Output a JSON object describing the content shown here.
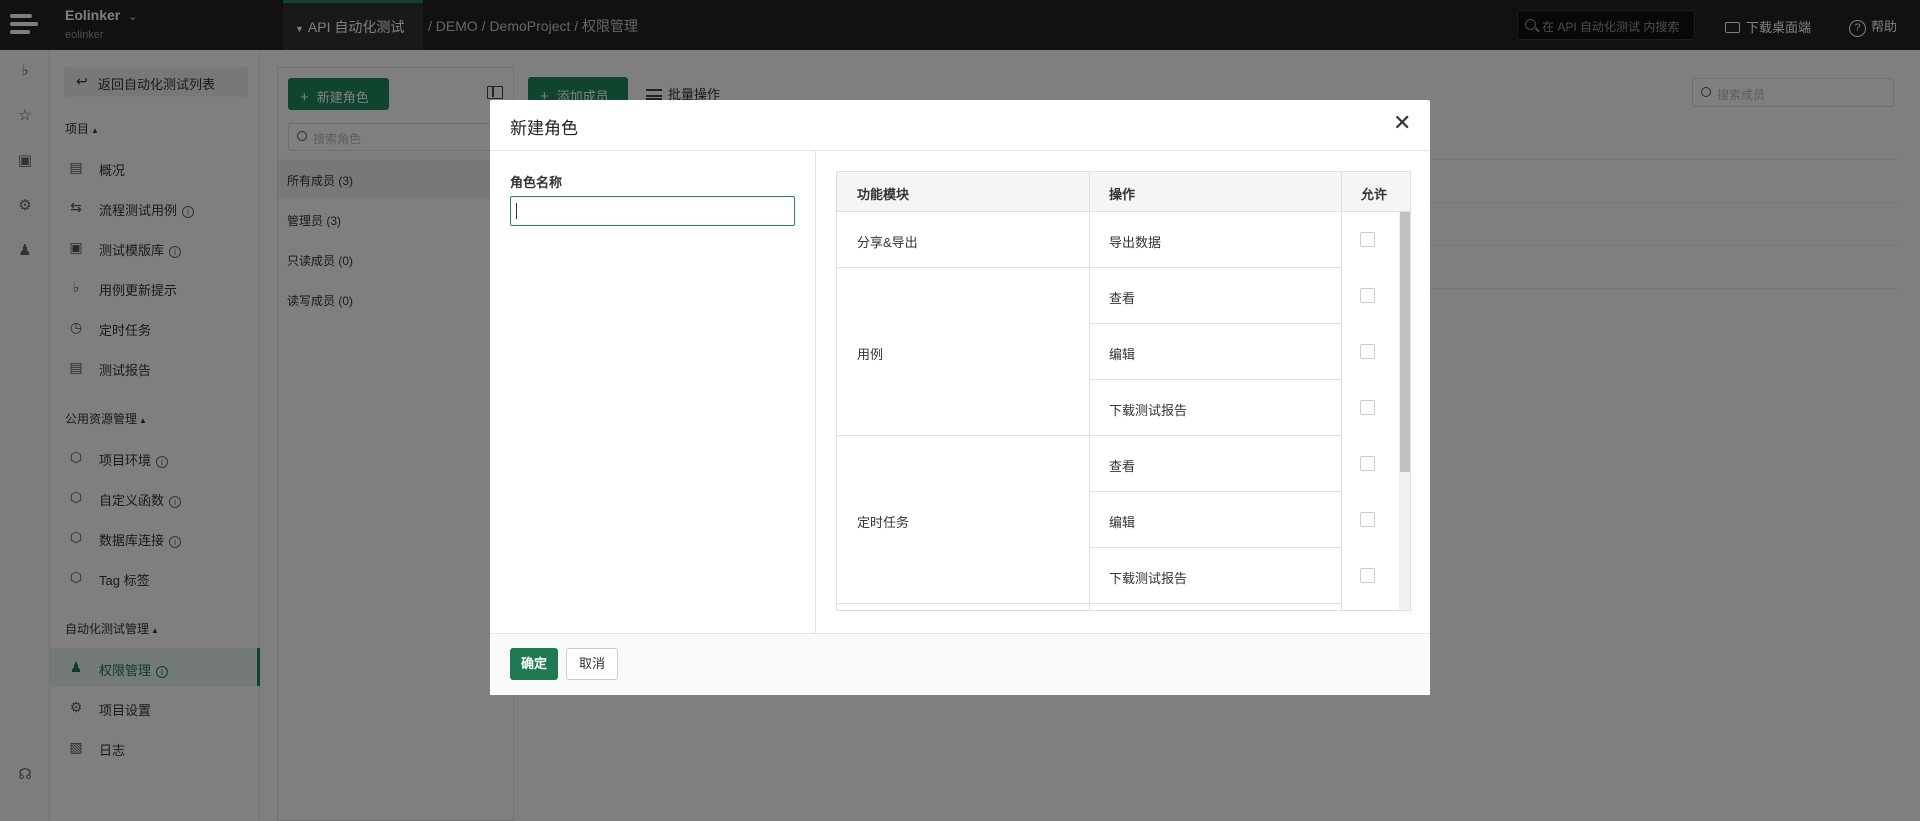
{
  "topbar": {
    "org_name": "Eolinker",
    "org_sub": "eolinker",
    "project_tab": "API 自动化测试",
    "breadcrumb": "/ DEMO / DemoProject / 权限管理",
    "search_placeholder": "在 API 自动化测试 内搜索",
    "download_label": "下载桌面端",
    "help_label": "帮助"
  },
  "sidenav": {
    "back_label": "返回自动化测试列表",
    "group_project": "项目",
    "group_public": "公用资源管理",
    "group_auto": "自动化测试管理",
    "items": [
      {
        "label": "概况",
        "icon": "dashboard-icon"
      },
      {
        "label": "流程测试用例",
        "icon": "flow-icon"
      },
      {
        "label": "测试模版库",
        "icon": "template-icon"
      },
      {
        "label": "用例更新提示",
        "icon": "bell-icon"
      },
      {
        "label": "定时任务",
        "icon": "clock-icon"
      },
      {
        "label": "测试报告",
        "icon": "report-icon"
      },
      {
        "label": "项目环境",
        "icon": "cube-icon"
      },
      {
        "label": "自定义函数",
        "icon": "cube-icon"
      },
      {
        "label": "数据库连接",
        "icon": "cube-icon"
      },
      {
        "label": "Tag 标签",
        "icon": "cube-icon"
      },
      {
        "label": "权限管理",
        "icon": "user-icon"
      },
      {
        "label": "项目设置",
        "icon": "gear-icon"
      },
      {
        "label": "日志",
        "icon": "log-icon"
      }
    ]
  },
  "roles": {
    "new_role_label": "新建角色",
    "search_placeholder": "搜索角色",
    "items": [
      "所有成员 (3)",
      "管理员 (3)",
      "只读成员 (0)",
      "读写成员 (0)"
    ]
  },
  "members": {
    "add_label": "添加成员",
    "batch_label": "批量操作",
    "search_placeholder": "搜索成员"
  },
  "modal": {
    "title": "新建角色",
    "field_label": "角色名称",
    "field_value": "",
    "table_headers": [
      "功能模块",
      "操作",
      "允许"
    ],
    "modules": [
      {
        "name": "分享&导出",
        "ops": [
          "导出数据"
        ]
      },
      {
        "name": "用例",
        "ops": [
          "查看",
          "编辑",
          "下载测试报告"
        ]
      },
      {
        "name": "定时任务",
        "ops": [
          "查看",
          "编辑",
          "下载测试报告"
        ]
      }
    ],
    "ok_label": "确定",
    "cancel_label": "取消"
  },
  "colors": {
    "accent": "#1f8a5f",
    "topbar": "#232323"
  }
}
